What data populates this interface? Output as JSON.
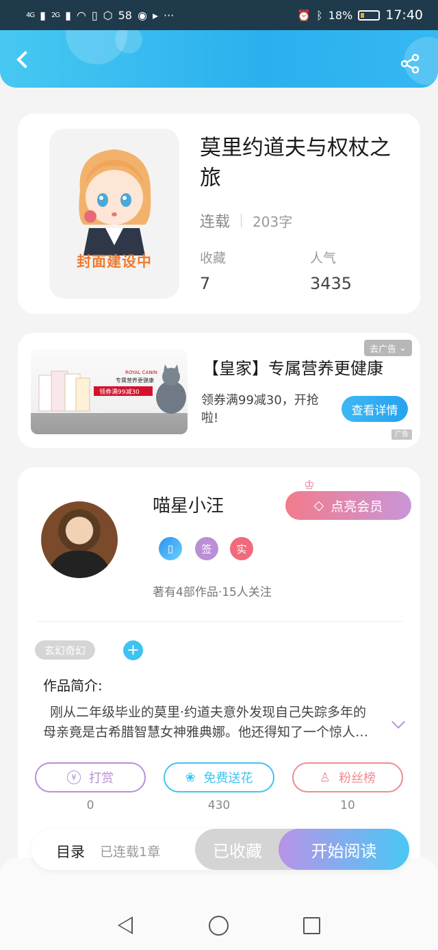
{
  "status_bar": {
    "signal_1": "4G",
    "signal_2": "2G",
    "notif_count": "58",
    "more": "···",
    "battery": "18%",
    "time": "17:40"
  },
  "header": {
    "back_icon": "chevron-left-icon",
    "share_icon": "share-icon"
  },
  "book": {
    "cover_text": "封面建设中",
    "title": "莫里约道夫与权杖之旅",
    "status": "连载",
    "word_count": "203字",
    "collect_label": "收藏",
    "collect_value": "7",
    "popularity_label": "人气",
    "popularity_value": "3435"
  },
  "ad": {
    "close_label": "去广告",
    "title": "【皇家】专属营养更健康",
    "desc": "领券满99减30，开抢啦!",
    "button": "查看详情",
    "mark": "广告",
    "img_brand": "ROYAL CANIN",
    "img_slogan": "专属营养更健康",
    "img_coupon": "领券满99减30"
  },
  "author": {
    "name": "喵星小汪",
    "vip_button": "点亮会员",
    "badge_sign": "签",
    "badge_real": "实",
    "stats": "著有4部作品·15人关注",
    "genre": "玄幻奇幻",
    "add_tag": "+",
    "intro_title": "作品简介:",
    "intro_text": "刚从二年级毕业的莫里·约道夫意外发现自己失踪多年的母亲竟是古希腊智慧女神雅典娜。他还得知了一个惊人的秘密……"
  },
  "actions": [
    {
      "label": "打赏",
      "count": "0",
      "color": "#b98fd6"
    },
    {
      "label": "免费送花",
      "count": "430",
      "color": "#3fc3f1"
    },
    {
      "label": "粉丝榜",
      "count": "10",
      "color": "#ef8a8f"
    }
  ],
  "bottom": {
    "toc": "目录",
    "toc_sub": "已连载1章",
    "favorited": "已收藏",
    "start_read": "开始阅读"
  },
  "colors": {
    "accent": "#2bb0ee",
    "vip": "#f27b8b",
    "cover_text": "#f07a2c"
  }
}
